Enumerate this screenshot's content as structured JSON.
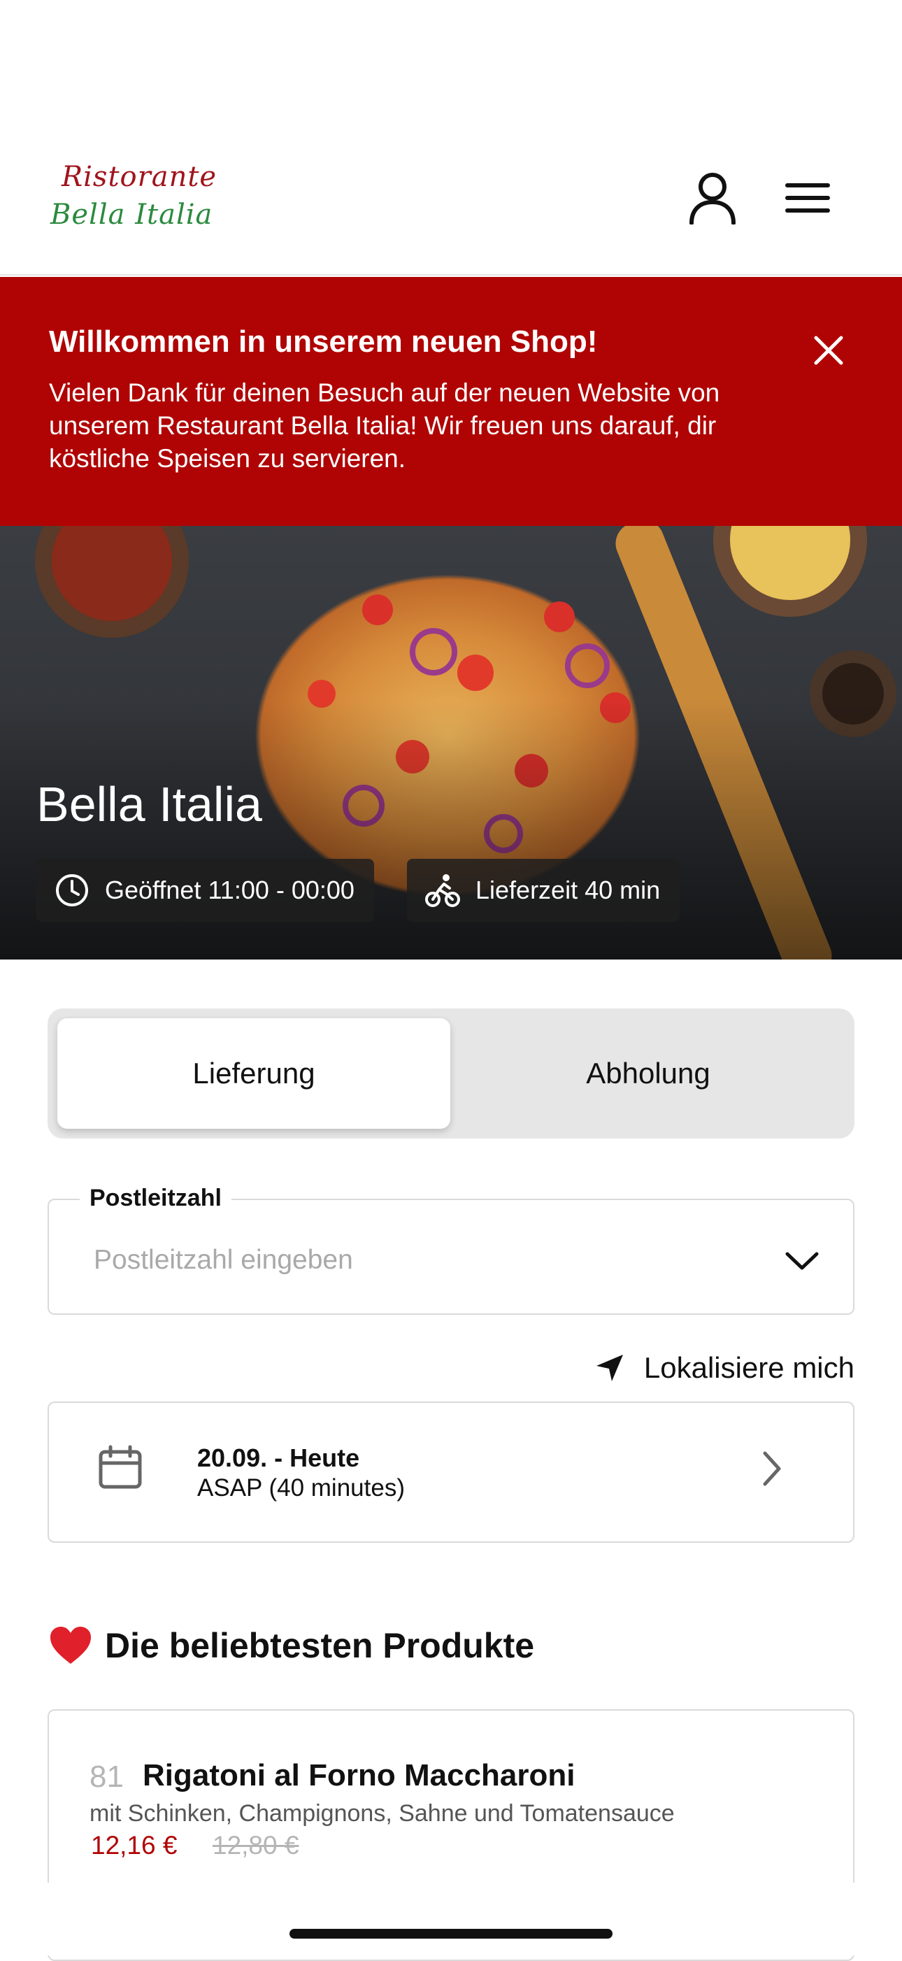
{
  "header": {
    "logo_line1": "Ristorante",
    "logo_line2": "Bella Italia",
    "account_icon": "user-icon",
    "menu_icon": "hamburger-menu-icon"
  },
  "banner": {
    "title": "Willkommen in unserem neuen Shop!",
    "text": "Vielen Dank für deinen Besuch auf der neuen Website von unserem Restaurant Bella Italia! Wir freuen uns darauf, dir köstliche Speisen zu servieren.",
    "close_icon": "close-icon",
    "background": "#b00404"
  },
  "hero": {
    "title": "Bella Italia",
    "open_label": "Geöffnet 11:00 - 00:00",
    "delivery_label": "Lieferzeit 40 min"
  },
  "order_mode": {
    "options": [
      "Lieferung",
      "Abholung"
    ],
    "selected": "Lieferung"
  },
  "postcode": {
    "label": "Postleitzahl",
    "placeholder": "Postleitzahl eingeben"
  },
  "locate": {
    "label": "Lokalisiere mich"
  },
  "schedule": {
    "date": "20.09. - Heute",
    "time": "ASAP (40 minutes)"
  },
  "popular": {
    "title": "Die beliebtesten Produkte",
    "items": [
      {
        "number": "81",
        "name": "Rigatoni al Forno Maccharoni",
        "description": "mit Schinken, Champignons, Sahne und Tomatensauce",
        "price": "12,16 €",
        "old_price": "12,80 €"
      }
    ]
  },
  "colors": {
    "accent": "#b00404",
    "logo_red": "#a0141c",
    "logo_green": "#2b8a3e"
  }
}
